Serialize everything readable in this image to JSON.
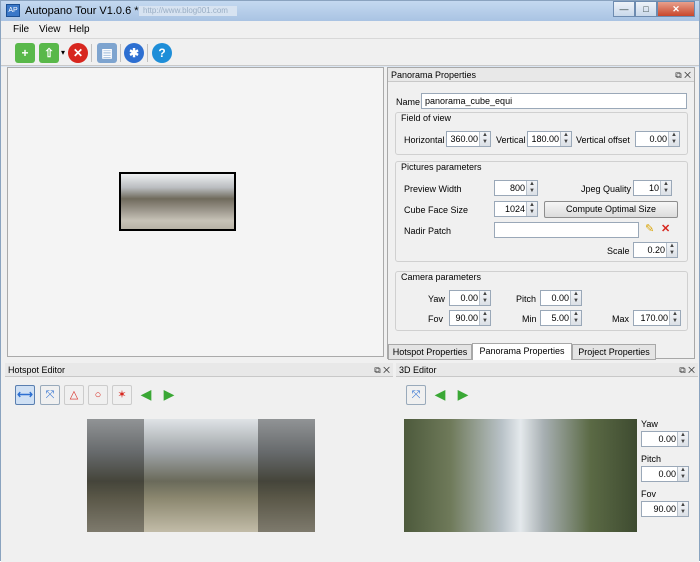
{
  "window": {
    "title": "Autopano Tour V1.0.6",
    "title_marker": "*",
    "url_watermark": "http://www.blog001.com",
    "buttons": {
      "minimize": "—",
      "maximize": "□",
      "close": "✕"
    }
  },
  "menu": {
    "file": "File",
    "view": "View",
    "help": "Help"
  },
  "toolbar": {
    "icons": [
      "new-tour-icon",
      "import-icon",
      "delete-icon",
      "add-panorama-icon",
      "settings-icon",
      "help-icon"
    ],
    "dropdown_glyph": "▾"
  },
  "panorama_properties": {
    "dock_title": "Panorama Properties",
    "name_label": "Name",
    "name_value": "panorama_cube_equi",
    "fov": {
      "section": "Field of view",
      "horizontal_label": "Horizontal",
      "horizontal_value": "360.00",
      "vertical_label": "Vertical",
      "vertical_value": "180.00",
      "vertical_offset_label": "Vertical offset",
      "vertical_offset_value": "0.00"
    },
    "pictures": {
      "section": "Pictures parameters",
      "preview_width_label": "Preview Width",
      "preview_width_value": "800",
      "jpeg_quality_label": "Jpeg Quality",
      "jpeg_quality_value": "10",
      "cube_face_label": "Cube Face Size",
      "cube_face_value": "1024",
      "compute_button": "Compute Optimal Size",
      "nadir_label": "Nadir Patch",
      "nadir_value": "",
      "scale_label": "Scale",
      "scale_value": "0.20"
    },
    "camera": {
      "section": "Camera parameters",
      "yaw_label": "Yaw",
      "yaw_value": "0.00",
      "pitch_label": "Pitch",
      "pitch_value": "0.00",
      "fov_label": "Fov",
      "fov_value": "90.00",
      "min_label": "Min",
      "min_value": "5.00",
      "max_label": "Max",
      "max_value": "170.00"
    },
    "tabs": [
      "Hotspot Properties",
      "Panorama Properties",
      "Project Properties"
    ],
    "active_tab": "Panorama Properties"
  },
  "hotspot_editor": {
    "title": "Hotspot Editor"
  },
  "editor_3d": {
    "title": "3D Editor",
    "yaw_label": "Yaw",
    "yaw_value": "0.00",
    "pitch_label": "Pitch",
    "pitch_value": "0.00",
    "fov_label": "Fov",
    "fov_value": "90.00"
  },
  "dock_buttons": "⧉ ✕",
  "colors": {
    "accent": "#3a78c8",
    "delete_red": "#d7261e",
    "arrow_green": "#3aa835"
  }
}
